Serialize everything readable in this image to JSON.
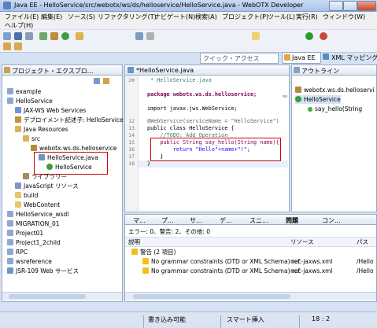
{
  "window": {
    "title": "Java EE - HelloService/src/webotx/ws/ds/helloservice/HelloService.java - WebOTX Developer"
  },
  "menu": [
    "ファイル(E)",
    "編集(E)",
    "ソース(S)",
    "リファクタリング(T)",
    "ナビゲート(N)",
    "検索(A)",
    "プロジェクト(P)",
    "ツール(L)",
    "実行(R)",
    "ウィンドウ(W)",
    "ヘルプ(H)"
  ],
  "toolbar": {
    "quick_access": "クイック・アクセス",
    "perspectives": [
      "Java EE",
      "XML マッピング"
    ]
  },
  "explorer": {
    "tab": "プロジェクト・エクスプロ...",
    "items": [
      "example",
      "HelloService",
      "JAX-WS Web Services",
      "デプロイメント記述子: HelloService",
      "Java Resources",
      "src",
      "webotx.ws.ds.helloservice",
      "HelloService.java",
      "HelloService",
      "ライブラリー",
      "JavaScript リソース",
      "build",
      "WebContent",
      "HelloService_wsdl",
      "MIGRATION_01",
      "Project01",
      "Project1_2child",
      "RPC",
      "wsreference",
      "JSR-109 Web サービス"
    ]
  },
  "editor": {
    "tab": "*HelloService.java",
    "gutter": [
      "2⊕",
      "",
      "",
      "",
      "",
      "",
      "",
      "",
      "12",
      "13",
      "14",
      "15",
      "16",
      "17",
      "18"
    ],
    "lines": [
      " * HelloService.java",
      "",
      "package webotx.ws.ds.helloservice;",
      "",
      "import javax.jws.WebService;",
      "",
      "@WebService(serviceName = \"HelloService\")",
      "public class HelloService {",
      "    //TODO: Add Operation",
      "    public String say_hello(String name){",
      "        return \"Hello\"+name+\"!\";",
      "    }",
      "}"
    ]
  },
  "outline": {
    "tab": "アウトライン",
    "items": [
      "webotx.ws.ds.helloservi",
      "HelloService",
      "say_hello(String"
    ]
  },
  "bottom": {
    "tabs": [
      "マ...",
      "プ...",
      "サ...",
      "デ...",
      "スニ...",
      "問題",
      "コン..."
    ],
    "summary": "エラー: 0、警告: 2、その他: 0",
    "headers": [
      "説明",
      "リソース",
      "パス"
    ],
    "group": "警告 (2 項目)",
    "rows": [
      {
        "desc": "No grammar constraints (DTD or XML Schema) ref",
        "res": "nec-jaxws.xml",
        "path": "/Hello"
      },
      {
        "desc": "No grammar constraints (DTD or XML Schema) ref",
        "res": "nec-jaxws.xml",
        "path": "/Hello"
      }
    ]
  },
  "status": {
    "write": "書き込み可能",
    "insert": "スマート挿入",
    "pos": "18 : 2"
  }
}
